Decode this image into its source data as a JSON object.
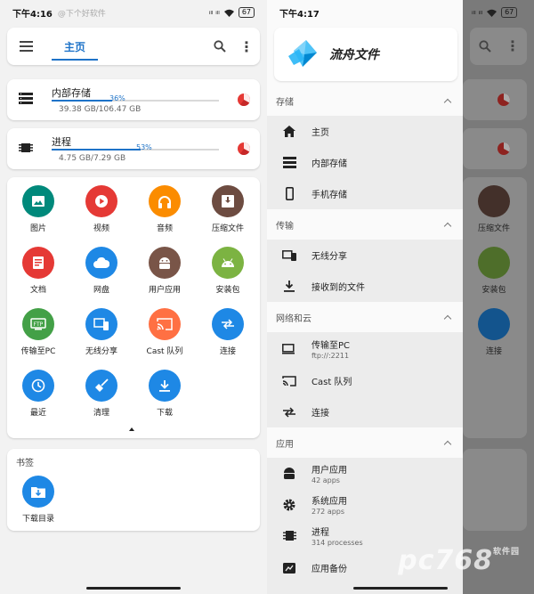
{
  "left": {
    "status": {
      "time": "下午4:16",
      "notif": "@下个好软件",
      "signal": "ᵢₗₗ ᵢₗₗ",
      "battery": "67"
    },
    "appbar": {
      "tab_home": "主页"
    },
    "storage": [
      {
        "title": "内部存储",
        "percent_label": "36%",
        "percent": 36,
        "sub": "39.38 GB/106.47 GB"
      },
      {
        "title": "进程",
        "percent_label": "53%",
        "percent": 53,
        "sub": "4.75 GB/7.29 GB"
      }
    ],
    "grid": [
      {
        "label": "图片",
        "icon": "image-icon",
        "color": "#00897b"
      },
      {
        "label": "视频",
        "icon": "play-icon",
        "color": "#e53935"
      },
      {
        "label": "音频",
        "icon": "headphones-icon",
        "color": "#fb8c00"
      },
      {
        "label": "压缩文件",
        "icon": "archive-icon",
        "color": "#6d4c41"
      },
      {
        "label": "文档",
        "icon": "document-icon",
        "color": "#e53935"
      },
      {
        "label": "网盘",
        "icon": "cloud-icon",
        "color": "#1e88e5"
      },
      {
        "label": "用户应用",
        "icon": "android-icon",
        "color": "#795548"
      },
      {
        "label": "安装包",
        "icon": "android-icon",
        "color": "#7cb342"
      },
      {
        "label": "传输至PC",
        "icon": "ftp-icon",
        "color": "#43a047"
      },
      {
        "label": "无线分享",
        "icon": "devices-icon",
        "color": "#1e88e5"
      },
      {
        "label": "Cast 队列",
        "icon": "cast-icon",
        "color": "#ff7043"
      },
      {
        "label": "连接",
        "icon": "swap-icon",
        "color": "#1e88e5"
      },
      {
        "label": "最近",
        "icon": "clock-icon",
        "color": "#1e88e5"
      },
      {
        "label": "清理",
        "icon": "broom-icon",
        "color": "#1e88e5"
      },
      {
        "label": "下载",
        "icon": "download-icon",
        "color": "#1e88e5"
      }
    ],
    "bookmarks": {
      "title": "书签",
      "items": [
        {
          "label": "下载目录"
        }
      ]
    }
  },
  "right": {
    "status": {
      "time": "下午4:17",
      "signal": "ᵢₗₗ ᵢₗₗ",
      "battery": "67"
    },
    "brand": {
      "name": "流舟文件"
    },
    "sections": {
      "storage": {
        "title": "存储",
        "items": [
          "主页",
          "内部存储",
          "手机存储"
        ]
      },
      "transfer": {
        "title": "传输",
        "items": [
          "无线分享",
          "接收到的文件"
        ]
      },
      "network": {
        "title": "网络和云",
        "items": [
          {
            "label": "传输至PC",
            "sub": "ftp://:2211"
          },
          {
            "label": "Cast 队列"
          },
          {
            "label": "连接"
          }
        ]
      },
      "apps": {
        "title": "应用",
        "items": [
          {
            "label": "用户应用",
            "sub": "42 apps"
          },
          {
            "label": "系统应用",
            "sub": "272 apps"
          },
          {
            "label": "进程",
            "sub": "314 processes"
          },
          {
            "label": "应用备份"
          }
        ]
      }
    },
    "bg_labels": [
      "压缩文件",
      "安装包",
      "连接"
    ]
  },
  "watermark": {
    "text": "pc768",
    "small": "软件园"
  }
}
